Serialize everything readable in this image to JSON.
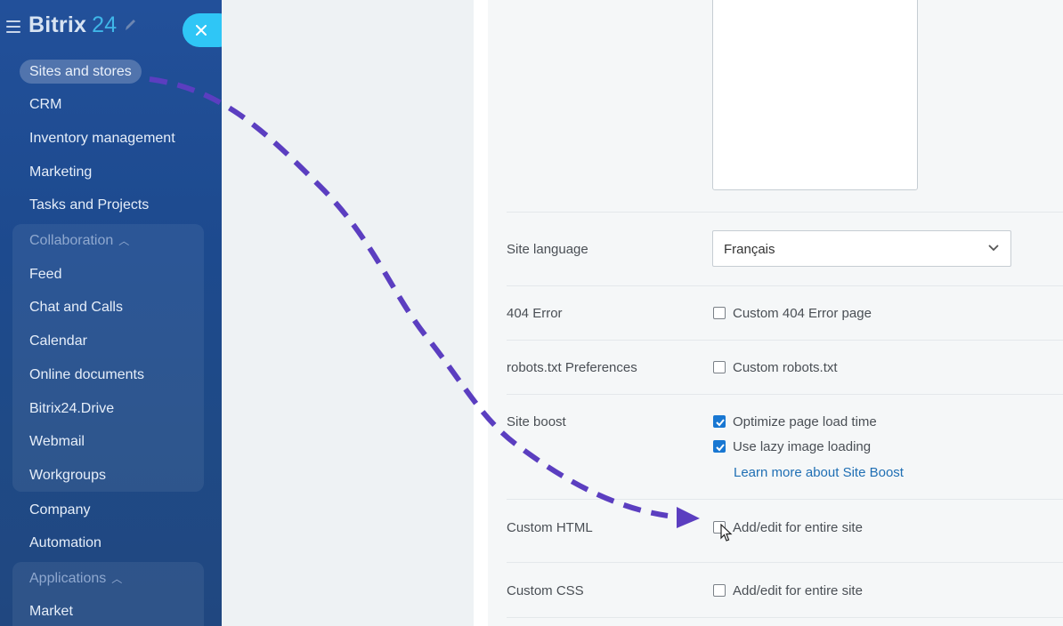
{
  "app": {
    "logo_text": "Bitrix",
    "logo_number": "24"
  },
  "sidebar": {
    "active_item": "Sites and stores",
    "items": [
      {
        "label": "CRM"
      },
      {
        "label": "Inventory management"
      },
      {
        "label": "Marketing"
      },
      {
        "label": "Tasks and Projects"
      }
    ],
    "collaboration": {
      "title": "Collaboration",
      "items": [
        {
          "label": "Feed"
        },
        {
          "label": "Chat and Calls"
        },
        {
          "label": "Calendar"
        },
        {
          "label": "Online documents"
        },
        {
          "label": "Bitrix24.Drive"
        },
        {
          "label": "Webmail"
        },
        {
          "label": "Workgroups"
        }
      ]
    },
    "items_after": [
      {
        "label": "Company"
      },
      {
        "label": "Automation"
      }
    ],
    "applications": {
      "title": "Applications",
      "items": [
        {
          "label": "Market"
        }
      ]
    }
  },
  "settings": {
    "site_language": {
      "label": "Site language",
      "value": "Français"
    },
    "error_404": {
      "label": "404 Error",
      "option": "Custom 404 Error page",
      "checked": false
    },
    "robots": {
      "label": "robots.txt Preferences",
      "option": "Custom robots.txt",
      "checked": false
    },
    "site_boost": {
      "label": "Site boost",
      "options": [
        {
          "text": "Optimize page load time",
          "checked": true
        },
        {
          "text": "Use lazy image loading",
          "checked": true
        }
      ],
      "link": "Learn more about Site Boost"
    },
    "custom_html": {
      "label": "Custom HTML",
      "option": "Add/edit for entire site",
      "checked": false
    },
    "custom_css": {
      "label": "Custom CSS",
      "option": "Add/edit for entire site",
      "checked": false
    }
  },
  "colors": {
    "sidebar_bg": "#1f4c8f",
    "accent": "#2fc6f6",
    "checkbox_checked": "#1877d2",
    "arrow": "#5b3ec0",
    "link": "#1f6fb4"
  },
  "icons": [
    "menu-icon",
    "pencil-icon",
    "close-icon",
    "chevron-down-icon",
    "checkmark-icon",
    "mouse-cursor-icon",
    "dashed-arrow"
  ]
}
